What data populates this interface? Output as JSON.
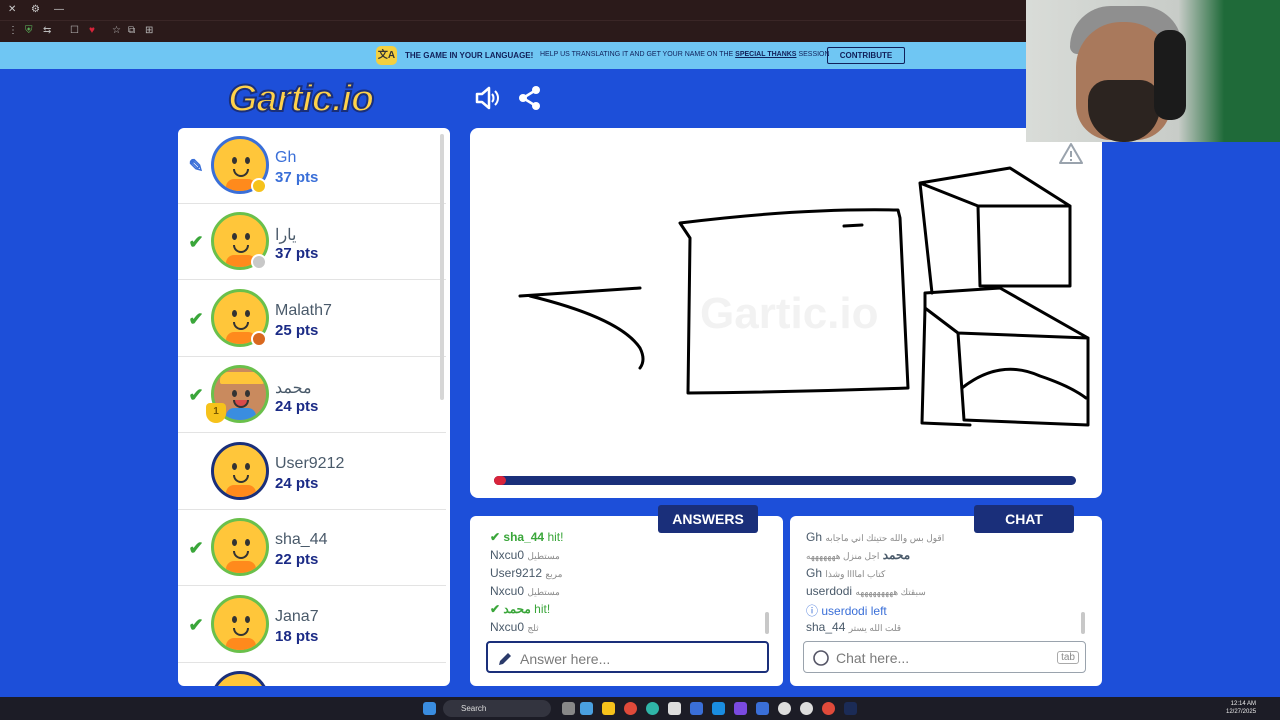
{
  "browser": {
    "controls": [
      "✕",
      "⚙",
      "—"
    ],
    "toolbar_icons": [
      "⋮",
      "⛨",
      "⇆",
      "☐",
      "♥",
      "☆",
      "⧉",
      "⊞"
    ]
  },
  "banner": {
    "title": "THE GAME IN YOUR LANGUAGE!",
    "text_before": "HELP US TRANSLATING IT AND GET YOUR NAME ON THE",
    "text_link": "SPECIAL THANKS",
    "text_after": "SESSION",
    "icon_text": "文A",
    "contribute_label": "CONTRIBUTE"
  },
  "header": {
    "logo": "Gartic.io",
    "sound_icon": "🔈",
    "share_icon": "share-icon"
  },
  "players": [
    {
      "name": "Gh",
      "points": "37 pts",
      "status": "drawing",
      "dot_color": "#f6c21b",
      "highlight": true
    },
    {
      "name": "يارا",
      "points": "37 pts",
      "status": "hit",
      "dot_color": "#c8c8c8"
    },
    {
      "name": "Malath7",
      "points": "25 pts",
      "status": "hit",
      "dot_color": "#d9681e"
    },
    {
      "name": "محمد",
      "points": "24 pts",
      "status": "hit",
      "dot_color": "",
      "rank": "1"
    },
    {
      "name": "User9212",
      "points": "24 pts",
      "status": "none",
      "dot_color": ""
    },
    {
      "name": "sha_44",
      "points": "22 pts",
      "status": "hit",
      "dot_color": ""
    },
    {
      "name": "Jana7",
      "points": "18 pts",
      "status": "hit",
      "dot_color": ""
    }
  ],
  "round": {
    "time_remaining_fraction": 0.98,
    "progress_track_color": "#1a2f7a",
    "progress_fill_color": "#d9243b"
  },
  "answers": {
    "tab_label": "ANSWERS",
    "messages": [
      {
        "user": "sha_44",
        "text": "hit!",
        "type": "hit"
      },
      {
        "user": "Nxcu0",
        "text": "مستطيل",
        "type": "guess"
      },
      {
        "user": "User9212",
        "text": "مربع",
        "type": "guess"
      },
      {
        "user": "Nxcu0",
        "text": "مستطيل",
        "type": "guess"
      },
      {
        "user": "محمد",
        "text": "hit!",
        "type": "hit"
      },
      {
        "user": "Nxcu0",
        "text": "ثلج",
        "type": "guess"
      }
    ],
    "placeholder": "Answer here..."
  },
  "chat": {
    "tab_label": "CHAT",
    "messages": [
      {
        "user": "Gh",
        "text": "اقول بس والله حتيتك اني ماجابه",
        "type": "msg"
      },
      {
        "user": "محمد",
        "text": "اجل منزل هههههههه",
        "type": "msg"
      },
      {
        "user": "Gh",
        "text": "كتاب اماااا وشذا",
        "type": "msg"
      },
      {
        "user": "userdodi",
        "text": "سبقتك هههههههههه",
        "type": "msg"
      },
      {
        "user": "userdodi",
        "text": "left",
        "type": "info"
      },
      {
        "user": "sha_44",
        "text": "قلت الله يستر",
        "type": "msg"
      }
    ],
    "placeholder": "Chat here...",
    "tab_key": "tab"
  },
  "taskbar": {
    "search_label": "Search",
    "time": "12:14 AM",
    "date": "12/27/2025"
  }
}
